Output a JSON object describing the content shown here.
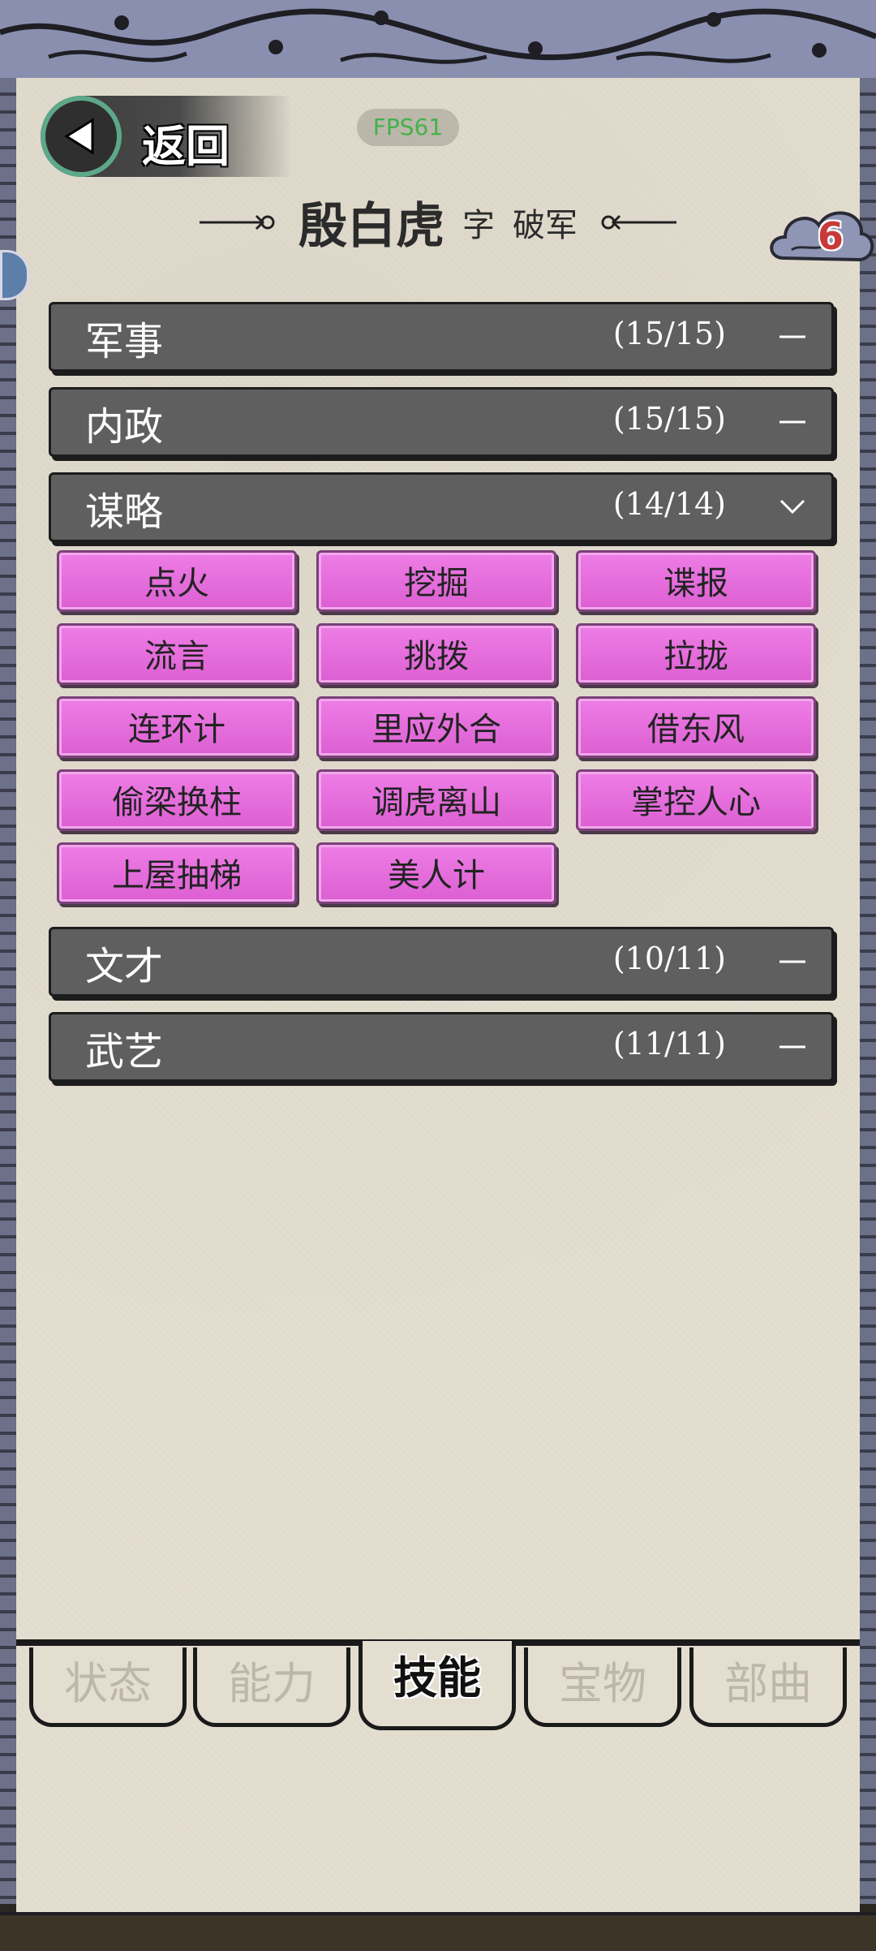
{
  "header": {
    "back_label": "返回",
    "fps_label": "FPS61",
    "character_name": "殷白虎",
    "zi_label": "字",
    "courtesy_name": "破军",
    "cloud_count": "6"
  },
  "sections": [
    {
      "title": "军事",
      "count": "(15/15)",
      "state": "collapsed"
    },
    {
      "title": "内政",
      "count": "(15/15)",
      "state": "collapsed"
    },
    {
      "title": "谋略",
      "count": "(14/14)",
      "state": "expanded",
      "skills": [
        "点火",
        "挖掘",
        "谍报",
        "流言",
        "挑拨",
        "拉拢",
        "连环计",
        "里应外合",
        "借东风",
        "偷梁换柱",
        "调虎离山",
        "掌控人心",
        "上屋抽梯",
        "美人计"
      ]
    },
    {
      "title": "文才",
      "count": "(10/11)",
      "state": "collapsed"
    },
    {
      "title": "武艺",
      "count": "(11/11)",
      "state": "collapsed"
    }
  ],
  "tabs": [
    {
      "label": "状态",
      "active": false
    },
    {
      "label": "能力",
      "active": false
    },
    {
      "label": "技能",
      "active": true
    },
    {
      "label": "宝物",
      "active": false
    },
    {
      "label": "部曲",
      "active": false
    }
  ],
  "colors": {
    "paper": "#e4ded0",
    "section_bar": "#5f5f5f",
    "skill_button": "#e36fd9",
    "fps_text": "#43b24a",
    "cloud_count": "#c83a3a"
  }
}
